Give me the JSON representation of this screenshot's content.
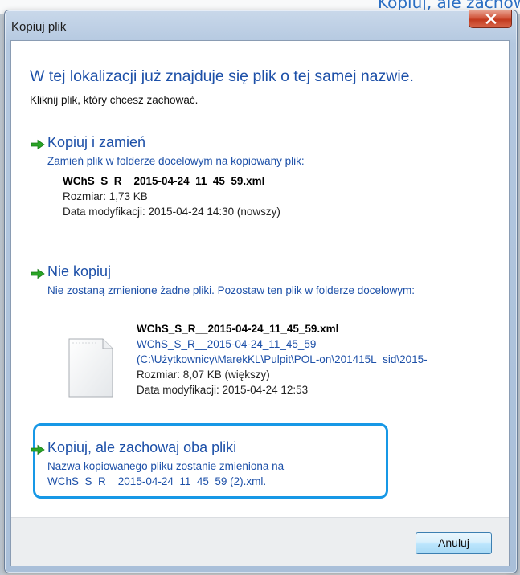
{
  "top_strip_text": "Kopiuj, ale zachowaj",
  "window": {
    "title": "Kopiuj plik"
  },
  "dialog": {
    "heading": "W tej lokalizacji już znajduje się plik o tej samej nazwie.",
    "subheading": "Kliknij plik, który chcesz zachować."
  },
  "options": [
    {
      "title": "Kopiuj i zamień",
      "description": "Zamień plik w folderze docelowym na kopiowany plik:",
      "file_name": "WChS_S_R__2015-04-24_11_45_59.xml",
      "size": "Rozmiar: 1,73 KB",
      "modified": "Data modyfikacji: 2015-04-24 14:30 (nowszy)"
    },
    {
      "title": "Nie kopiuj",
      "description": "Nie zostaną zmienione żadne pliki. Pozostaw ten plik w folderze docelowym:",
      "file_name": "WChS_S_R__2015-04-24_11_45_59.xml",
      "file_link": "WChS_S_R__2015-04-24_11_45_59",
      "path": "(C:\\Użytkownicy\\MarekKL\\Pulpit\\POL-on\\201415L_sid\\2015-",
      "size": "Rozmiar: 8,07 KB (większy)",
      "modified": "Data modyfikacji: 2015-04-24 12:53"
    },
    {
      "title": "Kopiuj, ale zachowaj oba pliki",
      "description_line1": "Nazwa kopiowanego pliku zostanie zmieniona na",
      "description_line2": "WChS_S_R__2015-04-24_11_45_59 (2).xml."
    }
  ],
  "footer": {
    "cancel_label": "Anuluj"
  },
  "colors": {
    "heading_blue": "#1d50a8",
    "arrow_green": "#2aa526",
    "highlight_blue": "#1798e6",
    "close_red": "#c23a1e"
  },
  "icons": {
    "close": "close-x-icon",
    "option_arrow": "green-arrow-icon",
    "file": "document-file-icon"
  }
}
